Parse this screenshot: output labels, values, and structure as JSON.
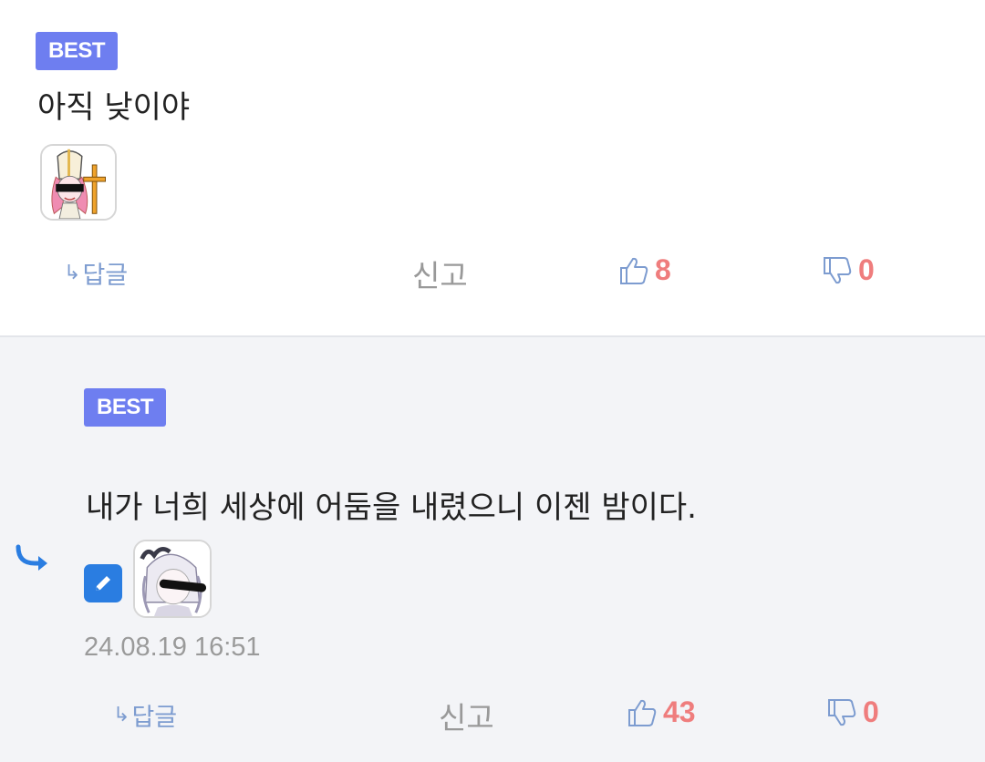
{
  "comments": [
    {
      "badge": "BEST",
      "text": "아직 낮이야",
      "avatar": "avatar-bishop-girl",
      "actions": {
        "reply_label": "답글",
        "report_label": "신고",
        "likes": "8",
        "dislikes": "0"
      }
    },
    {
      "badge": "BEST",
      "text": "내가 너희 세상에 어둠을 내렸으니 이젠 밤이다.",
      "avatar": "avatar-white-hair-girl",
      "timestamp": "24.08.19 16:51",
      "actions": {
        "reply_label": "답글",
        "report_label": "신고",
        "likes": "43",
        "dislikes": "0"
      }
    }
  ],
  "icons": {
    "reply_arrow": "reply-arrow-icon",
    "edit": "pencil-icon",
    "thumbs_up": "thumbs-up-icon",
    "thumbs_down": "thumbs-down-icon"
  },
  "colors": {
    "badge": "#6e7ef0",
    "link_blue": "#7d9cd0",
    "vote_red": "#ef7d7d",
    "reply_bg": "#f3f4f7",
    "edit_blue": "#2a7de1"
  }
}
